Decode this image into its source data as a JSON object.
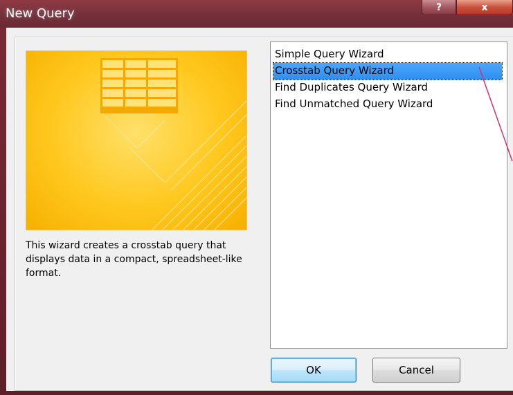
{
  "window": {
    "title": "New Query",
    "help_label": "?",
    "close_label": "x"
  },
  "preview": {
    "description": "This wizard creates a crosstab query that displays data in a compact, spreadsheet-like format."
  },
  "wizards": [
    {
      "label": "Simple Query Wizard",
      "selected": false
    },
    {
      "label": "Crosstab Query Wizard",
      "selected": true
    },
    {
      "label": "Find Duplicates Query Wizard",
      "selected": false
    },
    {
      "label": "Find Unmatched Query Wizard",
      "selected": false
    }
  ],
  "buttons": {
    "ok_label": "OK",
    "cancel_label": "Cancel"
  },
  "colors": {
    "frame": "#6b2530",
    "selection": "#3399ff",
    "preview_accent": "#ffc81e",
    "annotation_line": "#d1307a"
  }
}
